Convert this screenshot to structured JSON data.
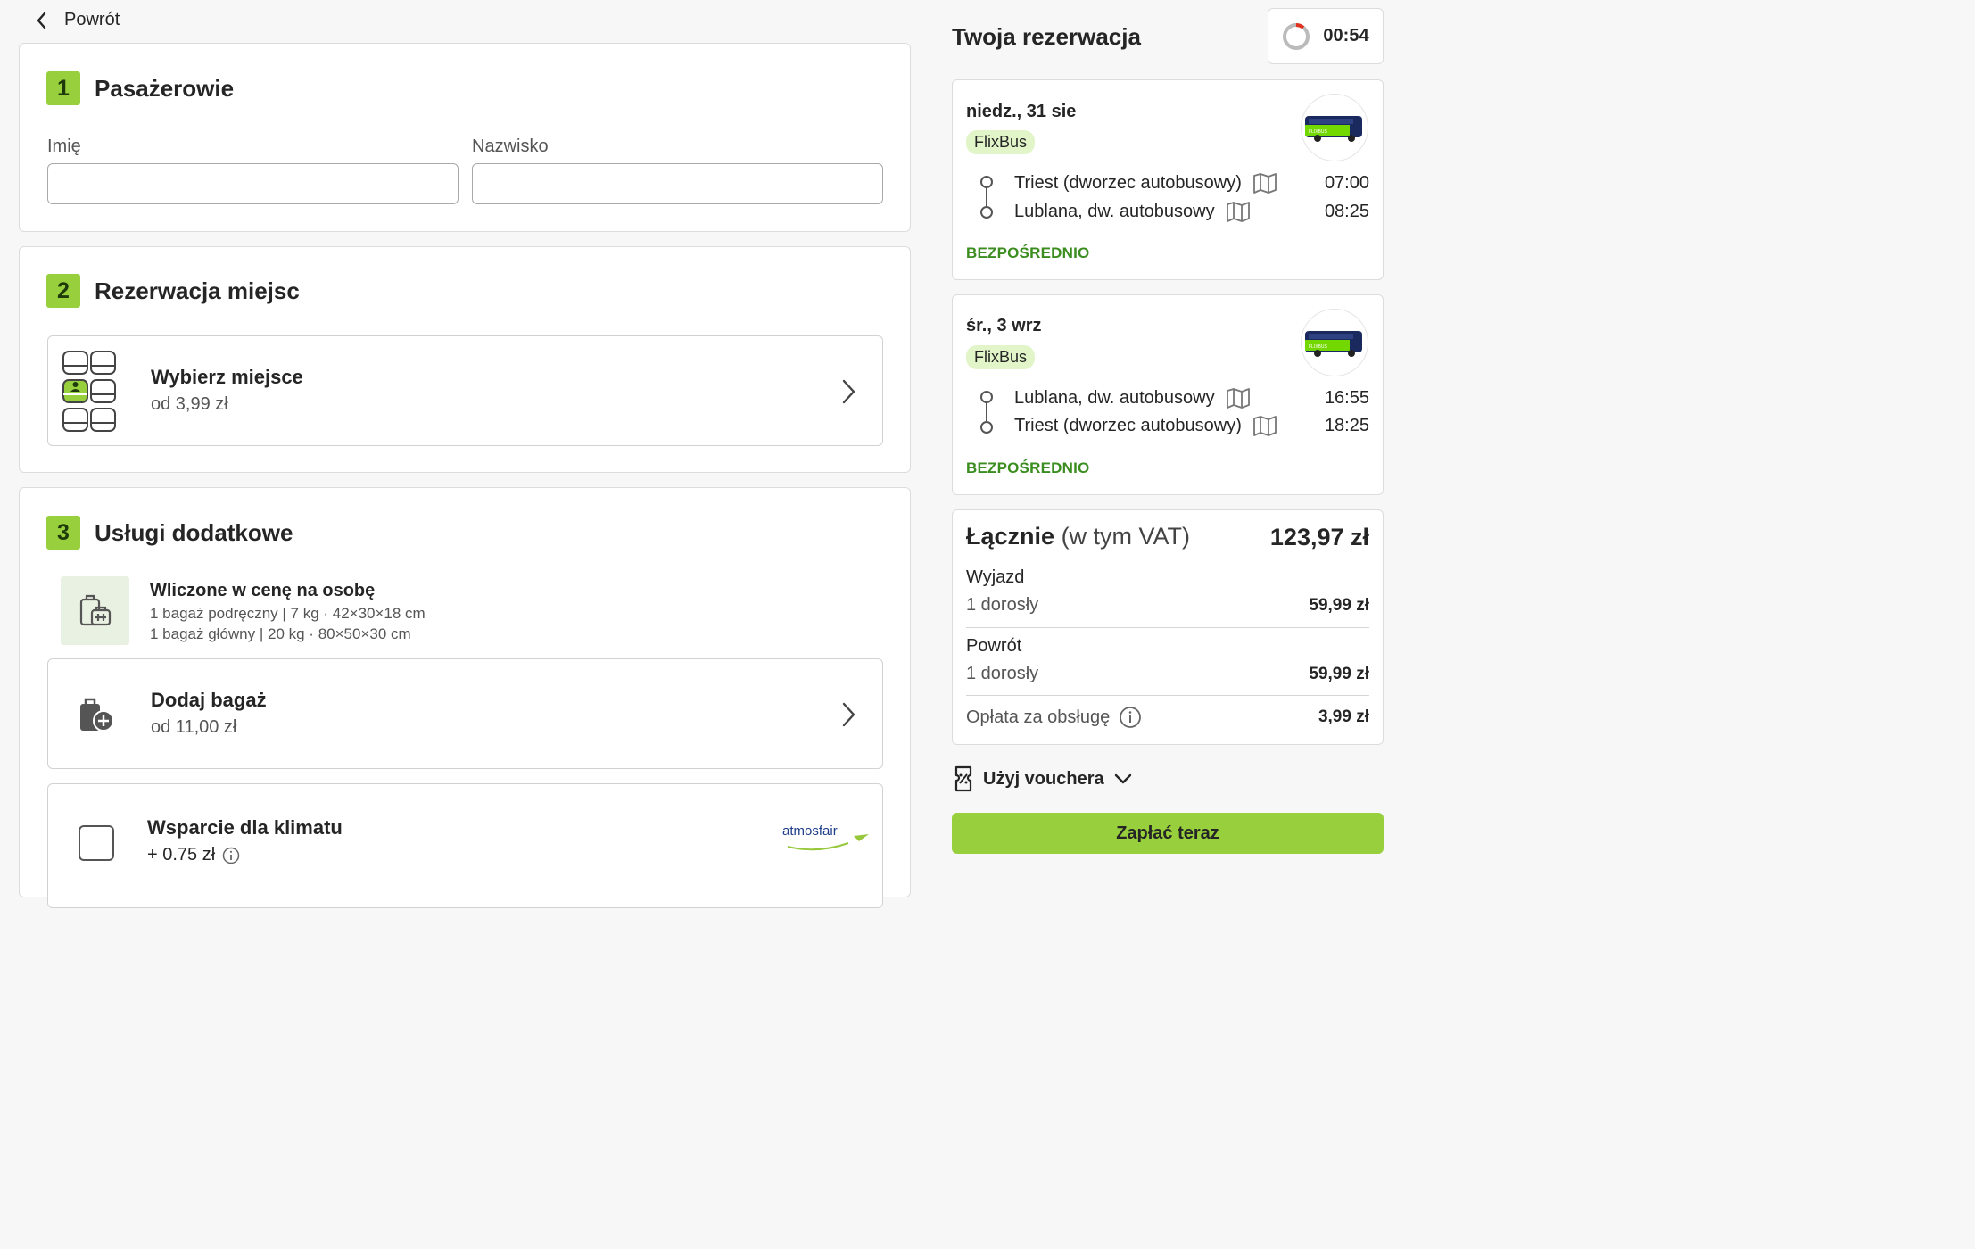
{
  "nav": {
    "back_label": "Powrót"
  },
  "passengers": {
    "step": "1",
    "title": "Pasażerowie",
    "first_name_label": "Imię",
    "first_name_value": "",
    "last_name_label": "Nazwisko",
    "last_name_value": ""
  },
  "seats": {
    "step": "2",
    "title": "Rezerwacja miejsc",
    "option_title": "Wybierz miejsce",
    "option_price": "od 3,99 zł"
  },
  "extras": {
    "step": "3",
    "title": "Usługi dodatkowe",
    "included_title": "Wliczone w cenę na osobę",
    "included_line1": "1 bagaż podręczny | 7 kg · 42×30×18 cm",
    "included_line2": "1 bagaż główny | 20 kg · 80×50×30 cm",
    "add_bag_title": "Dodaj bagaż",
    "add_bag_price": "od 11,00 zł",
    "climate_title": "Wsparcie dla klimatu",
    "climate_price": "+ 0.75 zł",
    "climate_checked": false,
    "partner_logo": "atmosfair"
  },
  "sidebar": {
    "title": "Twoja rezerwacja",
    "timer": "00:54",
    "trips": [
      {
        "date": "niedz., 31 sie",
        "operator": "FlixBus",
        "from": "Triest (dworzec autobusowy)",
        "from_time": "07:00",
        "to": "Lublana, dw. autobusowy",
        "to_time": "08:25",
        "type": "BEZPOŚREDNIO"
      },
      {
        "date": "śr., 3 wrz",
        "operator": "FlixBus",
        "from": "Lublana, dw. autobusowy",
        "from_time": "16:55",
        "to": "Triest (dworzec autobusowy)",
        "to_time": "18:25",
        "type": "BEZPOŚREDNIO"
      }
    ],
    "summary": {
      "total_label": "Łącznie",
      "total_vat": "(w tym VAT)",
      "total_value": "123,97 zł",
      "outbound_label": "Wyjazd",
      "outbound_pax": "1 dorosły",
      "outbound_price": "59,99 zł",
      "return_label": "Powrót",
      "return_pax": "1 dorosły",
      "return_price": "59,99 zł",
      "fee_label": "Opłata za obsługę",
      "fee_price": "3,99 zł"
    },
    "voucher_label": "Użyj vouchera",
    "pay_label": "Zapłać teraz"
  },
  "colors": {
    "accent": "#97d03c",
    "accent_light": "#e2f5c8",
    "direct_text": "#3a8d1e",
    "text": "#252525"
  }
}
